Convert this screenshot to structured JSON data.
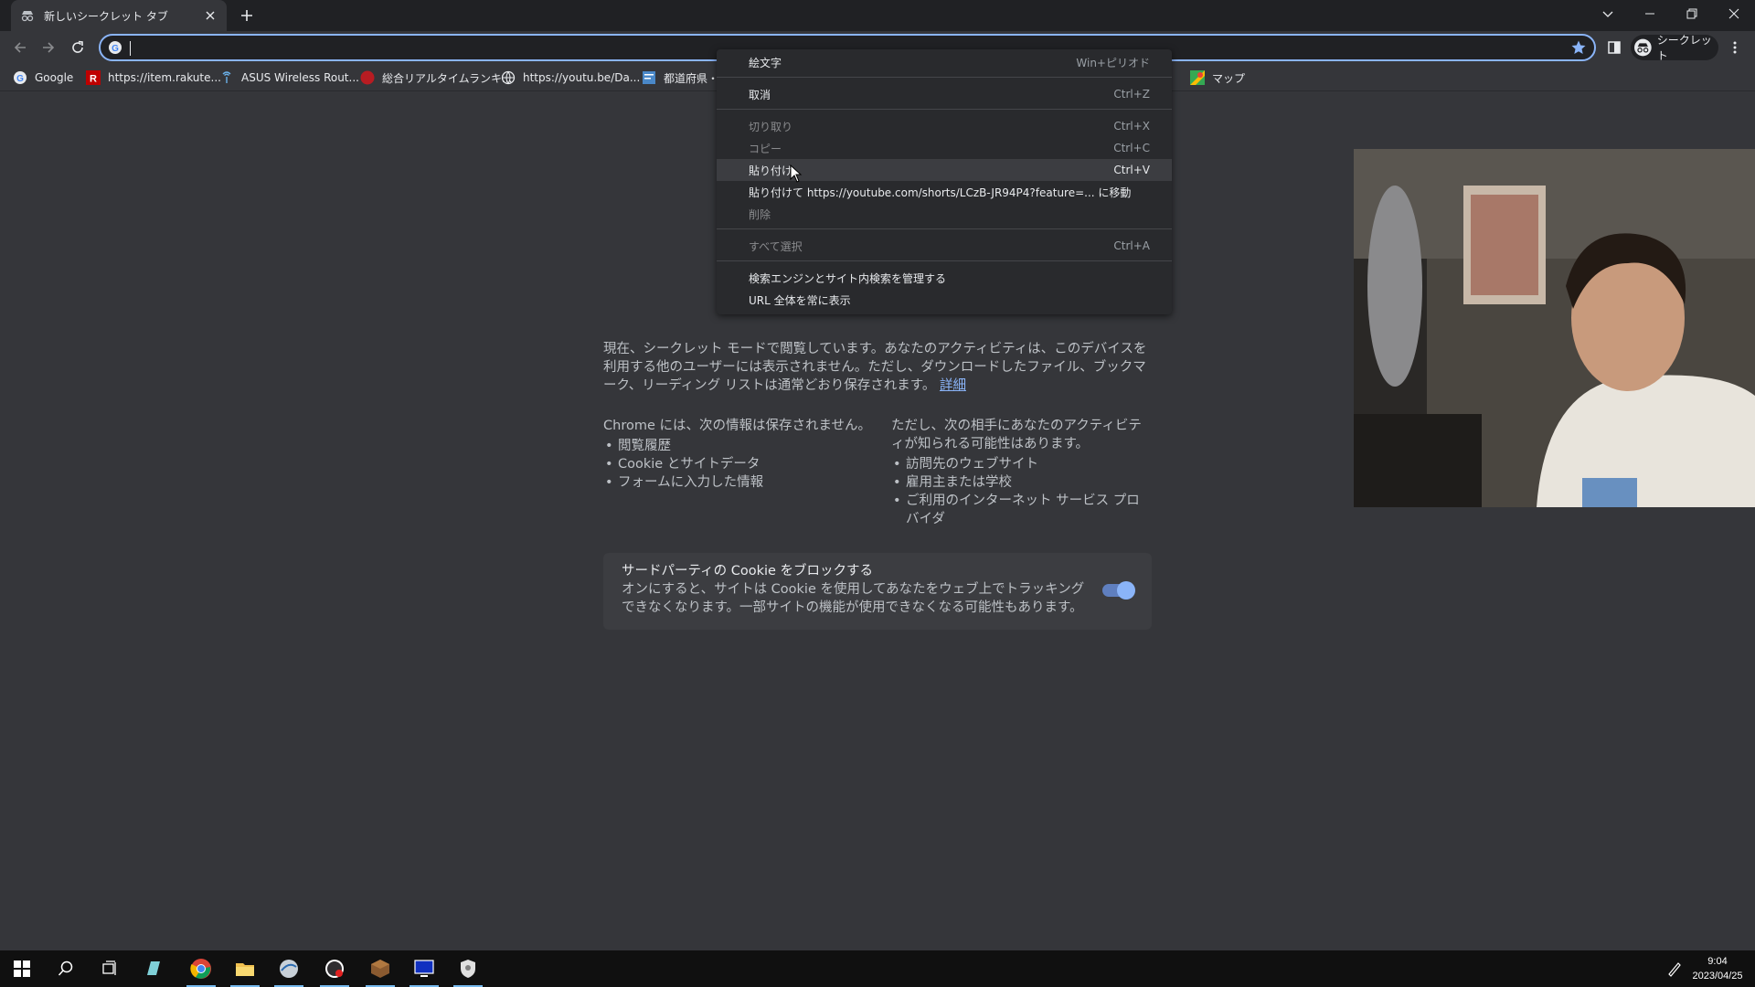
{
  "tab": {
    "title": "新しいシークレット タブ"
  },
  "omnibox": {
    "value": "",
    "placeholder": ""
  },
  "profile": {
    "label": "シークレット"
  },
  "bookmarks": [
    {
      "label": "Google",
      "icon": "google-icon"
    },
    {
      "label": "https://item.rakute...",
      "icon": "rakuten-icon"
    },
    {
      "label": "ASUS Wireless Rout...",
      "icon": "router-icon"
    },
    {
      "label": "総合リアルタイムランキ...",
      "icon": "ranking-icon"
    },
    {
      "label": "https://youtu.be/Da...",
      "icon": "globe-icon"
    },
    {
      "label": "都道府県・",
      "icon": "document-icon"
    },
    {
      "label": "マップ",
      "icon": "maps-icon"
    }
  ],
  "context_menu": {
    "items": [
      {
        "label": "絵文字",
        "shortcut": "Win+ピリオド",
        "disabled": false
      },
      {
        "label": "取消",
        "shortcut": "Ctrl+Z",
        "disabled": false
      },
      {
        "label": "切り取り",
        "shortcut": "Ctrl+X",
        "disabled": true
      },
      {
        "label": "コピー",
        "shortcut": "Ctrl+C",
        "disabled": true
      },
      {
        "label": "貼り付け",
        "shortcut": "Ctrl+V",
        "disabled": false
      },
      {
        "label": "貼り付けて https://youtube.com/shorts/LCzB-JR94P4?feature=... に移動",
        "shortcut": "",
        "disabled": false
      },
      {
        "label": "削除",
        "shortcut": "",
        "disabled": true
      },
      {
        "label": "すべて選択",
        "shortcut": "Ctrl+A",
        "disabled": true
      },
      {
        "label": "検索エンジンとサイト内検索を管理する",
        "shortcut": "",
        "disabled": false
      },
      {
        "label": "URL 全体を常に表示",
        "shortcut": "",
        "disabled": false
      }
    ]
  },
  "ntp": {
    "intro": "現在、シークレット モードで閲覧しています。あなたのアクティビティは、このデバイスを利用する他のユーザーには表示されません。ただし、ダウンロードしたファイル、ブックマーク、リーディング リストは通常どおり保存されます。",
    "learn_more": "詳細",
    "not_saved_heading": "Chrome には、次の情報は保存されません。",
    "not_saved_items": [
      "閲覧履歴",
      "Cookie とサイトデータ",
      "フォームに入力した情報"
    ],
    "visible_heading": "ただし、次の相手にあなたのアクティビティが知られる可能性はあります。",
    "visible_items": [
      "訪問先のウェブサイト",
      "雇用主または学校",
      "ご利用のインターネット サービス プロバイダ"
    ],
    "cookie_title": "サードパーティの Cookie をブロックする",
    "cookie_desc": "オンにすると、サイトは Cookie を使用してあなたをウェブ上でトラッキングできなくなります。一部サイトの機能が使用できなくなる可能性もあります。",
    "cookie_toggle_on": true
  },
  "taskbar": {
    "time": "9:04",
    "date": "2023/04/25"
  },
  "colors": {
    "accent": "#8ab4f8",
    "page_bg": "#35363a",
    "frame_bg": "#202124",
    "menu_bg": "#292a2d"
  }
}
